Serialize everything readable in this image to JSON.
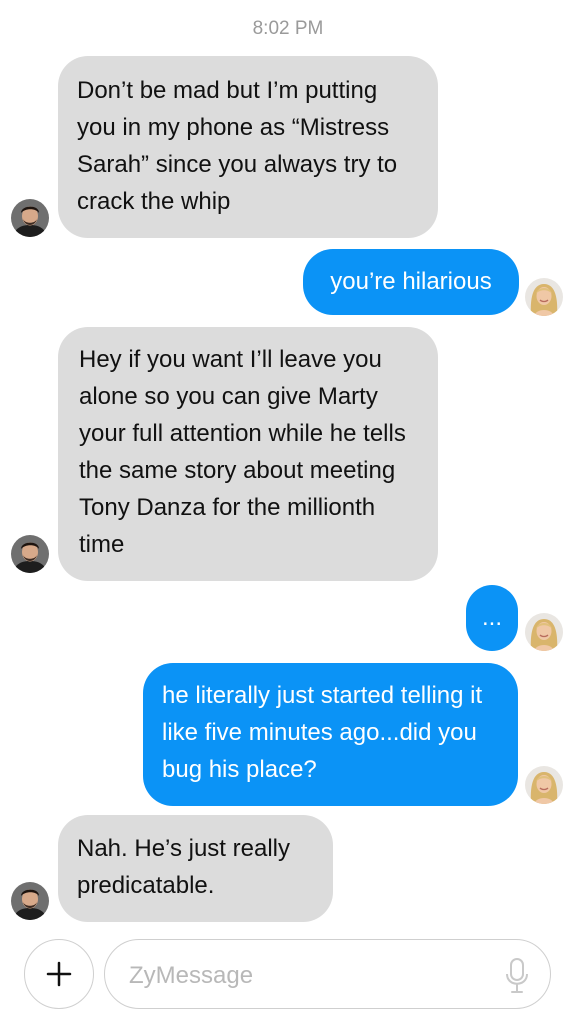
{
  "timestamp": "8:02 PM",
  "messages": [
    {
      "direction": "incoming",
      "text": "Don’t be mad but I’m putting you in my phone as “Mistress Sarah” since you always try to crack the whip"
    },
    {
      "direction": "outgoing",
      "text": "you’re hilarious"
    },
    {
      "direction": "incoming",
      "text": "Hey if you want I’ll leave you alone so you can give Marty your full attention while he tells the same story about meeting Tony Danza for the millionth time"
    },
    {
      "direction": "outgoing",
      "text": "..."
    },
    {
      "direction": "outgoing",
      "text": "he literally just started telling it like five minutes ago...did you bug his place?"
    },
    {
      "direction": "incoming",
      "text": "Nah. He’s just really predicatable."
    }
  ],
  "composer": {
    "placeholder": "ZyMessage",
    "add_icon": "plus-icon",
    "mic_icon": "microphone-icon"
  },
  "colors": {
    "incoming_bubble": "#dcdcdc",
    "outgoing_bubble": "#0b93f6",
    "timestamp": "#9a9a9a"
  }
}
